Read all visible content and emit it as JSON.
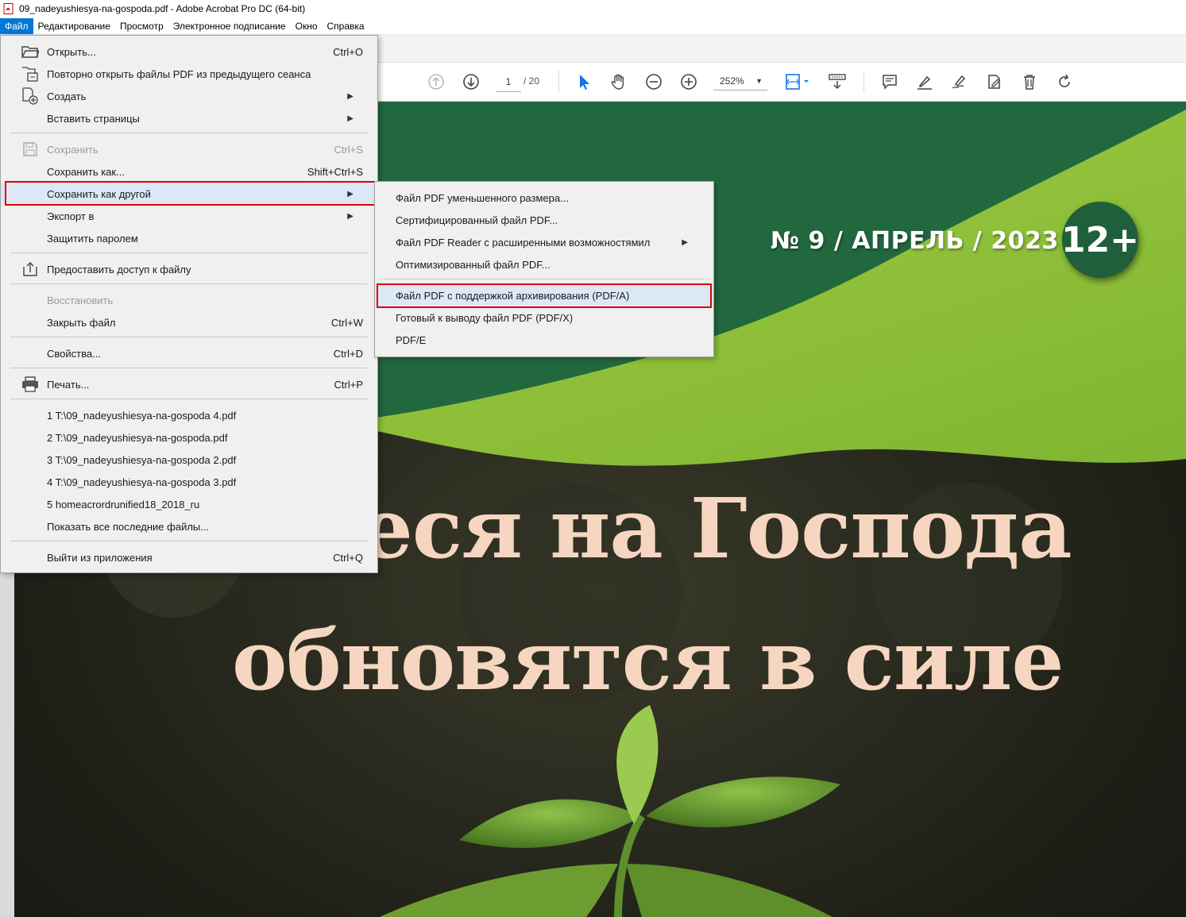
{
  "window": {
    "title": "09_nadeyushiesya-na-gospoda.pdf - Adobe Acrobat Pro DC (64-bit)"
  },
  "menubar": {
    "items": [
      "Файл",
      "Редактирование",
      "Просмотр",
      "Электронное подписание",
      "Окно",
      "Справка"
    ]
  },
  "toolbar": {
    "page_current": "1",
    "page_total": "/ 20",
    "zoom": "252%"
  },
  "file_menu": {
    "items": [
      {
        "label": "Открыть...",
        "shortcut": "Ctrl+O",
        "icon": "open-folder-icon"
      },
      {
        "label": "Повторно открыть файлы PDF из предыдущего сеанса",
        "shortcut": "",
        "icon": "reopen-icon"
      },
      {
        "label": "Создать",
        "shortcut": "",
        "icon": "create-icon",
        "submenu": true
      },
      {
        "label": "Вставить страницы",
        "shortcut": "",
        "submenu": true
      },
      {
        "label": "Сохранить",
        "shortcut": "Ctrl+S",
        "icon": "save-icon",
        "disabled": true
      },
      {
        "label": "Сохранить как...",
        "shortcut": "Shift+Ctrl+S"
      },
      {
        "label": "Сохранить как другой",
        "shortcut": "",
        "submenu": true,
        "highlighted": true
      },
      {
        "label": "Экспорт в",
        "shortcut": "",
        "submenu": true
      },
      {
        "label": "Защитить паролем",
        "shortcut": ""
      },
      {
        "label": "Предоставить доступ к файлу",
        "shortcut": "",
        "icon": "share-icon"
      },
      {
        "label": "Восстановить",
        "shortcut": "",
        "disabled": true
      },
      {
        "label": "Закрыть файл",
        "shortcut": "Ctrl+W"
      },
      {
        "label": "Свойства...",
        "shortcut": "Ctrl+D"
      },
      {
        "label": "Печать...",
        "shortcut": "Ctrl+P",
        "icon": "printer-icon"
      },
      {
        "label": "1 T:\\09_nadeyushiesya-na-gospoda 4.pdf",
        "shortcut": ""
      },
      {
        "label": "2 T:\\09_nadeyushiesya-na-gospoda.pdf",
        "shortcut": ""
      },
      {
        "label": "3 T:\\09_nadeyushiesya-na-gospoda 2.pdf",
        "shortcut": ""
      },
      {
        "label": "4 T:\\09_nadeyushiesya-na-gospoda 3.pdf",
        "shortcut": ""
      },
      {
        "label": "5 homeacrordrunified18_2018_ru",
        "shortcut": ""
      },
      {
        "label": "Показать все последние файлы...",
        "shortcut": ""
      },
      {
        "label": "Выйти из приложения",
        "shortcut": "Ctrl+Q"
      }
    ]
  },
  "save_as_other_submenu": {
    "items": [
      {
        "label": "Файл PDF уменьшенного размера..."
      },
      {
        "label": "Сертифицированный файл PDF..."
      },
      {
        "label": "Файл PDF Reader с расширенными возможностямил",
        "submenu": true
      },
      {
        "label": "Оптимизированный файл PDF..."
      },
      {
        "label": "Файл PDF с поддержкой архивирования (PDF/A)",
        "highlighted": true
      },
      {
        "label": "Готовый к выводу файл PDF (PDF/X)"
      },
      {
        "label": "PDF/E"
      }
    ]
  },
  "document": {
    "issue_line": "№ 9 / АПРЕЛЬ / 2023",
    "age_rating": "12+",
    "headline_line1": "щиеся на Господа",
    "headline_line2": "обновятся в силе"
  },
  "colors": {
    "accent": "#0078d7",
    "highlight_outline": "#e00000",
    "dark_green": "#1f5f3b",
    "light_green": "#8dbf3a",
    "headline": "#f6d6c0"
  }
}
